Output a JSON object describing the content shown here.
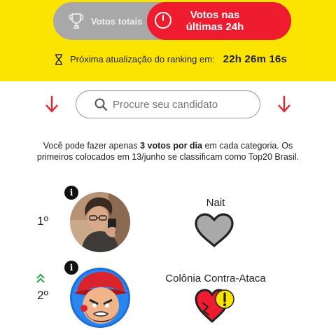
{
  "toggle": {
    "total_label": "Votos totais",
    "recent_label_line1": "Votos nas",
    "recent_label_line2": "últimas 24h"
  },
  "next_update": {
    "label": "Próxima atualização do ranking em:",
    "time": "22h 26m 16s"
  },
  "search": {
    "placeholder": "Procure seu candidato"
  },
  "info": {
    "text_before": "Você pode fazer apenas ",
    "text_bold": "3 votos por dia",
    "text_after": " em cada categoria. Os primeiros colocados em 13/junho se classificam como Top20 Brasil."
  },
  "candidates": [
    {
      "rank": "1º",
      "name": "Nait",
      "heart_state": "empty-gray",
      "trend": "none"
    },
    {
      "rank": "2º",
      "name": "Colônia Contra-Ataca",
      "heart_state": "red-warning",
      "trend": "up"
    }
  ],
  "colors": {
    "yellow": "#fce401",
    "red": "#ee1c2e",
    "gray_toggle": "#a8a8a8",
    "trend_green": "#2fa84f"
  },
  "icons": {
    "total": "trophy-icon",
    "recent": "clock-icon",
    "timer": "hourglass-icon",
    "search": "search-icon",
    "scroll": "arrow-down-icon",
    "info": "info-icon",
    "vote": "heart-icon",
    "trend": "double-chevron-up-icon"
  }
}
